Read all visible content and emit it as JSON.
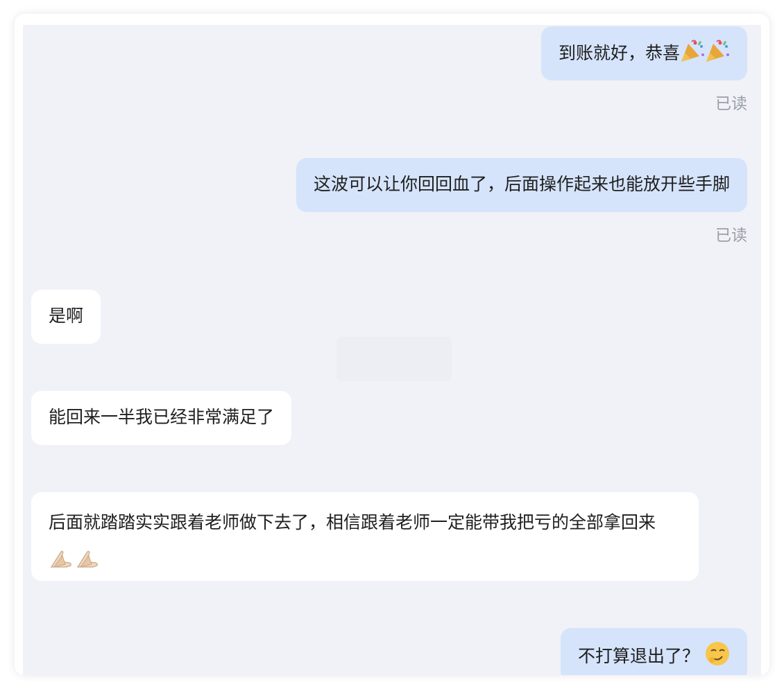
{
  "messages": [
    {
      "direction": "outgoing",
      "text": "到账就好，恭喜",
      "emoji": [
        "party-popper",
        "party-popper"
      ],
      "status": "已读"
    },
    {
      "direction": "outgoing",
      "text": "这波可以让你回回血了，后面操作起来也能放开些手脚",
      "status": "已读"
    },
    {
      "direction": "incoming",
      "text": "是啊"
    },
    {
      "direction": "incoming",
      "text": "能回来一半我已经非常满足了"
    },
    {
      "direction": "incoming",
      "text": "后面就踏踏实实跟着老师做下去了，相信跟着老师一定能带我把亏的全部拿回来",
      "emoji": [
        "folded-hands",
        "folded-hands"
      ]
    },
    {
      "direction": "outgoing",
      "text": "不打算退出了？",
      "emoji": [
        "smirking-face"
      ]
    }
  ],
  "colors": {
    "outgoing_bubble": "#d5e4fb",
    "incoming_bubble": "#ffffff",
    "chat_background": "#f0f2f7",
    "read_status": "#9aa0a8"
  }
}
